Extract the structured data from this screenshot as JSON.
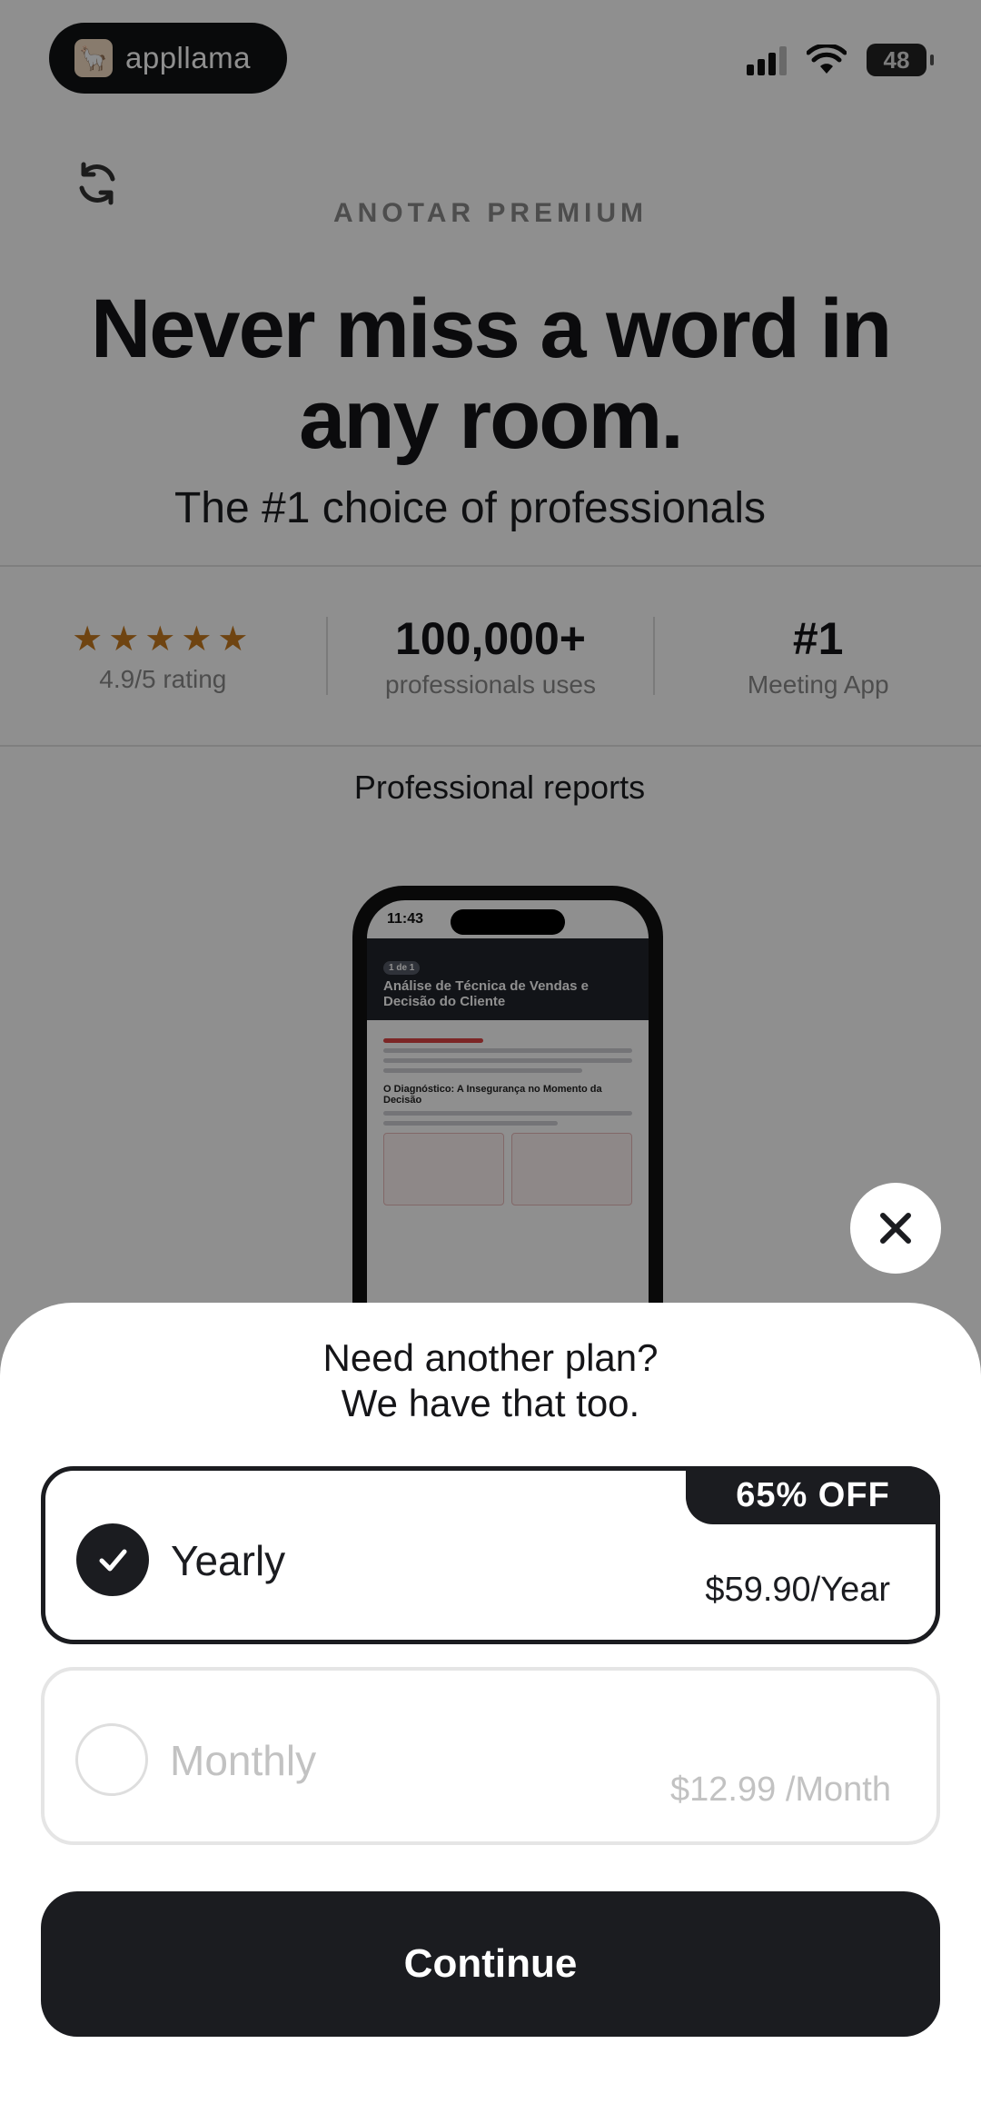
{
  "status_bar": {
    "brand_name": "appllama",
    "battery": "48"
  },
  "paywall": {
    "eyebrow": "ANOTAR PREMIUM",
    "headline": "Never miss a word in any room.",
    "subhead": "The #1 choice of professionals",
    "stats": [
      {
        "big": "★★★★★",
        "small": "4.9/5 rating"
      },
      {
        "big": "100,000+",
        "small": "professionals uses"
      },
      {
        "big": "#1",
        "small": "Meeting App"
      }
    ],
    "reports_title": "Professional reports",
    "mock_phone": {
      "time": "11:43",
      "pager": "1 de 1",
      "report_title": "Análise de Técnica de Vendas e Decisão do Cliente",
      "section_title": "O Diagnóstico: A Insegurança no Momento da Decisão"
    }
  },
  "sheet": {
    "title_line1": "Need another plan?",
    "title_line2": "We have that too.",
    "plans": [
      {
        "name": "Yearly",
        "price": "$59.90/Year",
        "badge": "65% OFF",
        "selected": true
      },
      {
        "name": "Monthly",
        "price": "$12.99 /Month",
        "selected": false
      }
    ],
    "continue_label": "Continue"
  },
  "colors": {
    "primary": "#1b1c20",
    "star": "#c67a1f",
    "muted": "#c2c2c2"
  }
}
